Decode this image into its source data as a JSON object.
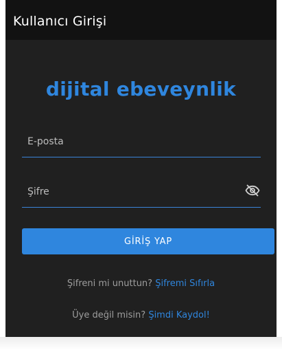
{
  "appbar": {
    "title": "Kullanıcı Girişi"
  },
  "brand": {
    "logo_text": "dijital ebeveynlik"
  },
  "form": {
    "email_placeholder": "E-posta",
    "email_value": "",
    "password_placeholder": "Şifre",
    "password_value": "",
    "password_toggle_icon": "eye-off-icon",
    "login_button": "GİRİŞ YAP"
  },
  "links": {
    "forgot_prompt": "Şifreni mi unuttun?",
    "forgot_link": "Şifremi Sıfırla",
    "register_prompt": "Üye değil misin?",
    "register_link": "Şimdi Kaydol!"
  },
  "colors": {
    "accent": "#2f86de",
    "background": "#202020",
    "appbar": "#121212"
  }
}
